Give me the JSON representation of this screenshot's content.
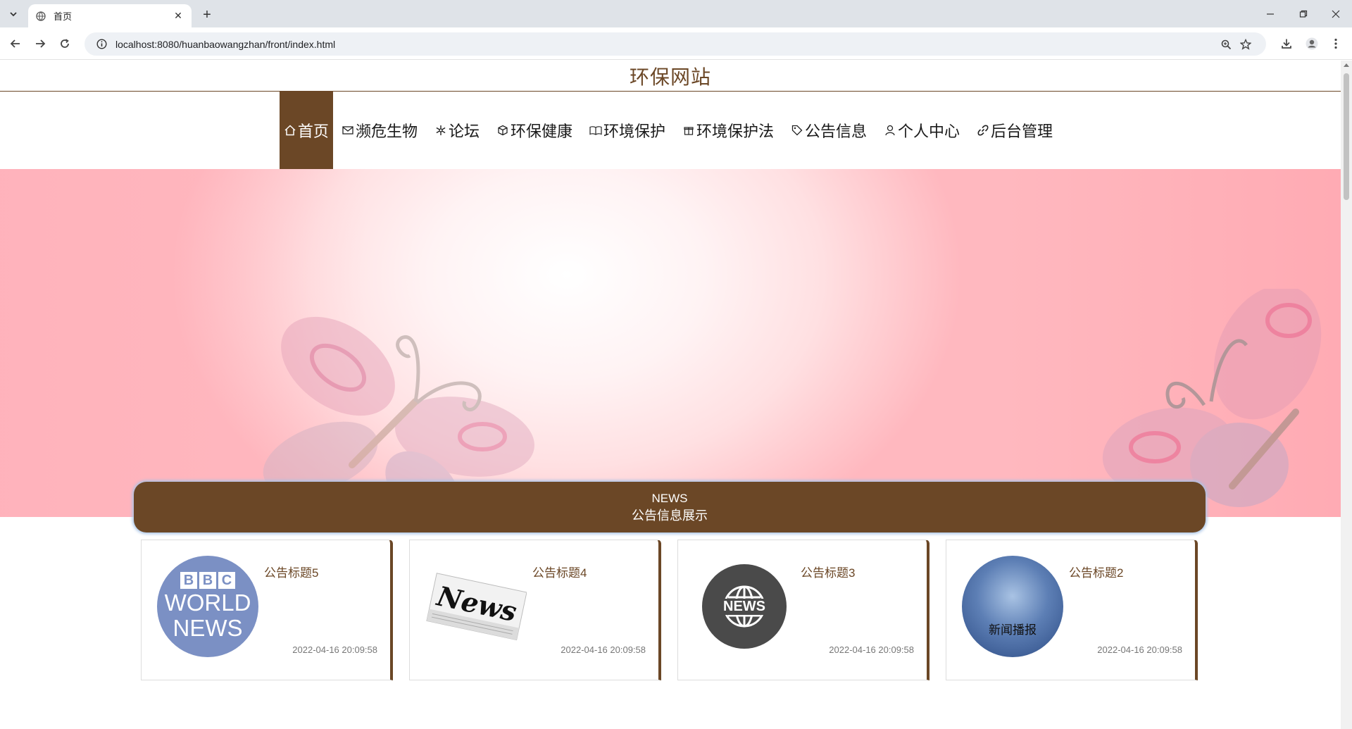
{
  "browser": {
    "tab_title": "首页",
    "url": "localhost:8080/huanbaowangzhan/front/index.html"
  },
  "site": {
    "title": "环保网站"
  },
  "nav": {
    "items": [
      {
        "label": "首页",
        "icon": "home-icon",
        "active": true
      },
      {
        "label": "濒危生物",
        "icon": "mail-icon"
      },
      {
        "label": "论坛",
        "icon": "snowflake-icon"
      },
      {
        "label": "环保健康",
        "icon": "cube-icon"
      },
      {
        "label": "环境保护",
        "icon": "book-icon"
      },
      {
        "label": "环境保护法",
        "icon": "gift-icon"
      },
      {
        "label": "公告信息",
        "icon": "tag-icon"
      },
      {
        "label": "个人中心",
        "icon": "user-icon"
      },
      {
        "label": "后台管理",
        "icon": "link-icon"
      }
    ]
  },
  "banner": {
    "slide_count": 3,
    "active_slide": 1
  },
  "news": {
    "heading_en": "NEWS",
    "heading_cn": "公告信息展示",
    "cards": [
      {
        "title": "公告标题5",
        "date": "2022-04-16 20:09:58",
        "thumb": "bbc-world-news",
        "thumb_lines": [
          "BBC",
          "WORLD",
          "NEWS"
        ]
      },
      {
        "title": "公告标题4",
        "date": "2022-04-16 20:09:58",
        "thumb": "newspaper",
        "thumb_text": "News"
      },
      {
        "title": "公告标题3",
        "date": "2022-04-16 20:09:58",
        "thumb": "globe-news",
        "thumb_text": "NEWS"
      },
      {
        "title": "公告标题2",
        "date": "2022-04-16 20:09:58",
        "thumb": "sky-broadcast",
        "thumb_text": "新闻播报"
      }
    ]
  },
  "colors": {
    "brand": "#6b4726",
    "news_bar_glow": "#a8c4e6"
  }
}
